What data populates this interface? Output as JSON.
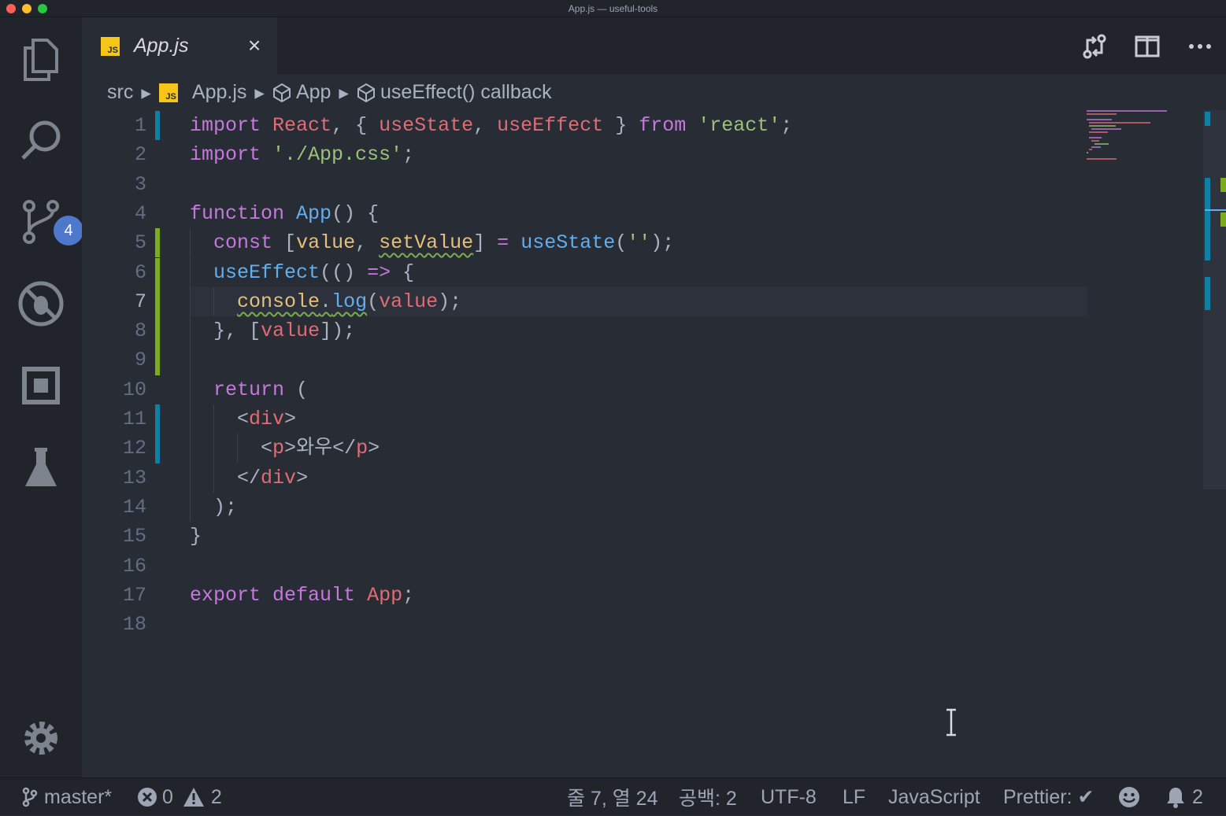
{
  "window": {
    "title": "App.js — useful-tools"
  },
  "activity": {
    "scm_badge": "4"
  },
  "tab": {
    "icon_text": "JS",
    "label": "App.js",
    "close": "×"
  },
  "breadcrumb": {
    "src": "src",
    "file_icon": "JS",
    "file": "App.js",
    "component": "App",
    "callback": "useEffect() callback"
  },
  "code": {
    "line_numbers": [
      "1",
      "2",
      "3",
      "4",
      "5",
      "6",
      "7",
      "8",
      "9",
      "10",
      "11",
      "12",
      "13",
      "14",
      "15",
      "16",
      "17",
      "18"
    ],
    "lines": [
      "import React, { useState, useEffect } from 'react';",
      "import './App.css';",
      "",
      "function App() {",
      "  const [value, setValue] = useState('');",
      "  useEffect(() => {",
      "    console.log(value);",
      "  }, [value]);",
      "",
      "  return (",
      "    <div>",
      "      <p>와우</p>",
      "    </div>",
      "  );",
      "}",
      "",
      "export default App;",
      ""
    ],
    "current_line": 7
  },
  "status": {
    "branch": "master*",
    "errors": "0",
    "warnings": "2",
    "position": "줄 7, 열 24",
    "spaces": "공백: 2",
    "encoding": "UTF-8",
    "eol": "LF",
    "language": "JavaScript",
    "formatter": "Prettier: ✔",
    "notifications": "2"
  },
  "colors": {
    "keyword": "#c678dd",
    "variable": "#e06c75",
    "function": "#61afef",
    "string": "#98c379",
    "param": "#e5c07b",
    "plain": "#abb2bf",
    "operator": "#56b6c2",
    "gutter_added": "#7cab1e",
    "gutter_modified": "#0f7fa3"
  }
}
